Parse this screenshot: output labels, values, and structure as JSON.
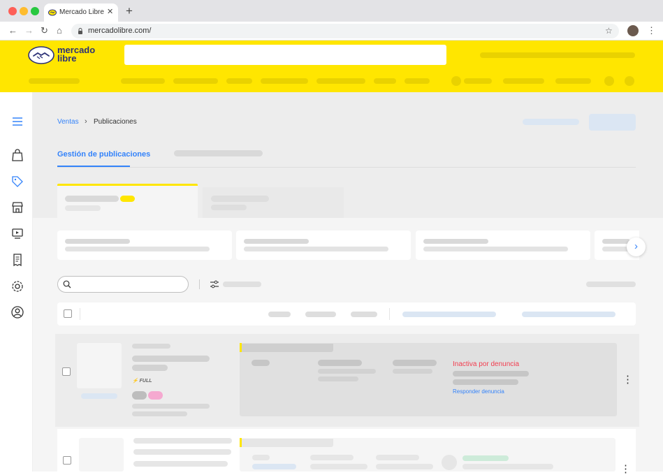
{
  "browser": {
    "tab_title": "Mercado Libre",
    "tab_close": "✕",
    "new_tab": "+",
    "url": "mercadolibre.com/",
    "nav_back": "←",
    "nav_forward": "→",
    "nav_reload": "↻",
    "nav_home": "⌂",
    "bookmark": "☆",
    "menu": "⋮",
    "lock": "🔒"
  },
  "header": {
    "logo_line1": "mercado",
    "logo_line2": "libre",
    "search_placeholder": ""
  },
  "breadcrumb": {
    "link": "Ventas",
    "separator": "›",
    "current": "Publicaciones"
  },
  "tabs": {
    "active": "Gestión de publicaciones"
  },
  "carousel": {
    "next": "›"
  },
  "listing": {
    "badge": "⚡ FULL",
    "status": "Inactiva por denuncia",
    "action": "Responder denuncia",
    "more": "⋮"
  },
  "colors": {
    "brand_yellow": "#ffe600",
    "link_blue": "#3483fa",
    "alert_red": "#f23d4f"
  }
}
